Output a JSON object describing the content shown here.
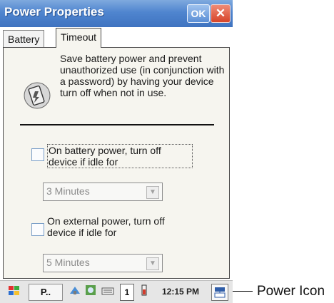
{
  "window": {
    "title": "Power Properties",
    "ok_label": "OK",
    "close_label": "✕"
  },
  "tabs": [
    {
      "label": "Battery",
      "active": false
    },
    {
      "label": "Timeout",
      "active": true
    }
  ],
  "panel": {
    "description": "Save battery power and prevent unauthorized use (in conjunction with a password) by having your device turn off when not in use.",
    "battery_option": {
      "label": "On battery power, turn off device if idle for",
      "checked": false,
      "dropdown_value": "3 Minutes"
    },
    "external_option": {
      "label": "On external power, turn off device if idle for",
      "checked": false,
      "dropdown_value": "5 Minutes"
    }
  },
  "taskbar": {
    "start_icon": "windows-flag-icon",
    "task_label": "P..",
    "tray_badge": "1",
    "clock": "12:15 PM",
    "power_icon": "power-icon"
  },
  "annotation": {
    "callout": "Power Icon"
  }
}
